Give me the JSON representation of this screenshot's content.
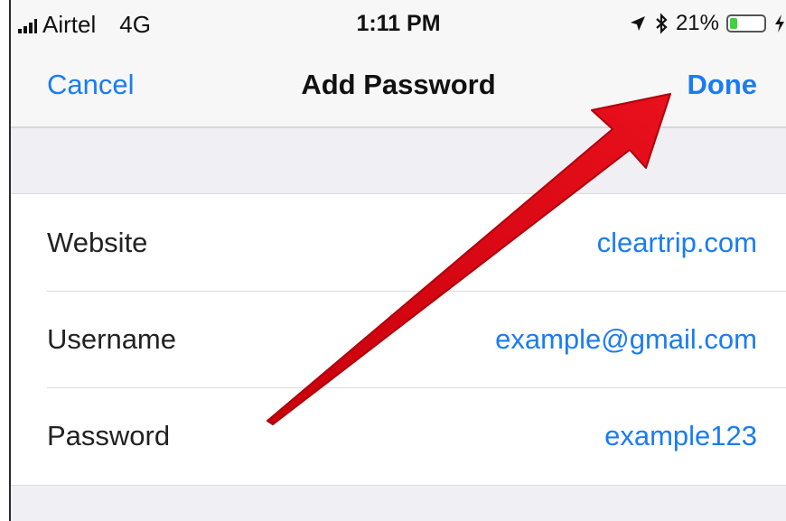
{
  "status_bar": {
    "carrier": "Airtel",
    "network": "4G",
    "time": "1:11 PM",
    "battery_percent": "21%",
    "battery_level": 0.21,
    "icons": [
      "signal-icon",
      "location-icon",
      "bluetooth-icon",
      "battery-icon",
      "charging-icon"
    ]
  },
  "nav": {
    "cancel_label": "Cancel",
    "title": "Add Password",
    "done_label": "Done"
  },
  "form": {
    "rows": [
      {
        "label": "Website",
        "value": "cleartrip.com"
      },
      {
        "label": "Username",
        "value": "example@gmail.com"
      },
      {
        "label": "Password",
        "value": "example123"
      }
    ]
  },
  "colors": {
    "accent": "#1a7cf4",
    "annotation_arrow": "#e0101a",
    "background": "#efeff4"
  }
}
